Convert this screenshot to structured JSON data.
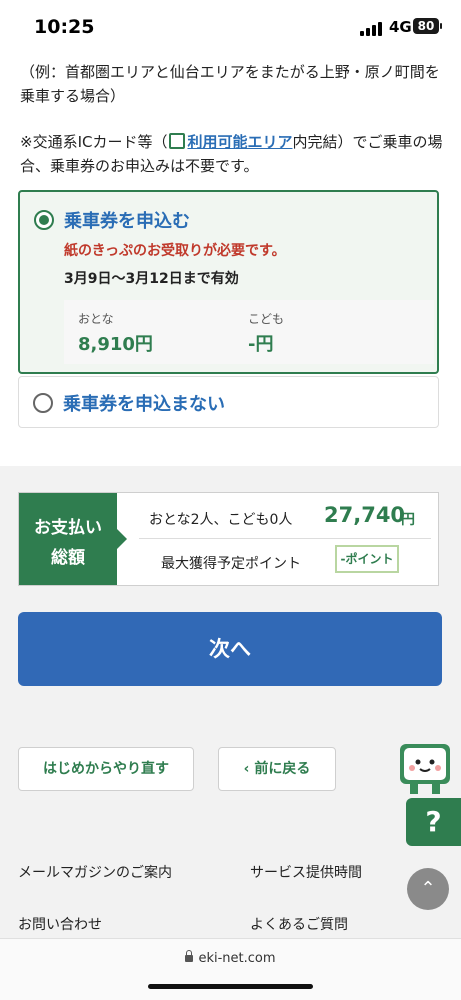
{
  "status_bar": {
    "time": "10:25",
    "network": "4G",
    "battery": "80"
  },
  "notes": {
    "example": "（例：首都圏エリアと仙台エリアをまたがる上野・原ノ町間を乗車する場合）",
    "ic_prefix": "※交通系ICカード等（",
    "ic_link": "利用可能エリア",
    "ic_suffix": "内完結）でご乗車の場合、乗車券のお申込みは不要です。"
  },
  "options": {
    "apply": {
      "label": "乗車券を申込む",
      "warning": "紙のきっぷのお受取りが必要です。",
      "validity": "3月9日〜3月12日まで有効",
      "adult_label": "おとな",
      "adult_price": "8,910円",
      "child_label": "こども",
      "child_price": "-円"
    },
    "not_apply": {
      "label": "乗車券を申込まない"
    }
  },
  "payment": {
    "label_line1": "お支払い",
    "label_line2": "総額",
    "people": "おとな2人、こども0人",
    "total": "27,740",
    "currency": "円",
    "points_label": "最大獲得予定ポイント",
    "points_value": "-ポイント"
  },
  "next_button": "次へ",
  "footer": {
    "restart_button": "はじめからやり直す",
    "back_button": "前に戻る",
    "help": "?",
    "links": [
      "メールマガジンのご案内",
      "サービス提供時間",
      "お問い合わせ",
      "よくあるご質問"
    ]
  },
  "browser": {
    "url": "eki-net.com"
  },
  "colors": {
    "brand_green": "#2f7d4f",
    "link_blue": "#2a6db5",
    "button_blue": "#3169b6",
    "warning_red": "#c0392b"
  }
}
